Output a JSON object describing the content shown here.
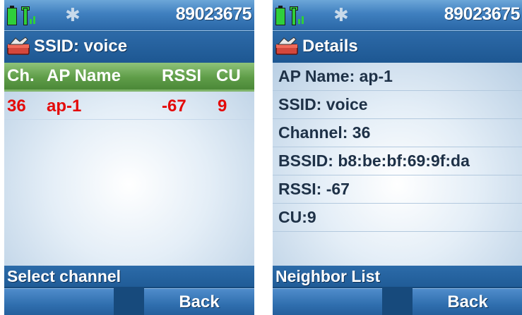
{
  "left_screen": {
    "status": {
      "number": "89023675",
      "battery_icon": "battery-icon",
      "signal_icon": "signal-icon",
      "bluetooth_icon": "bluetooth-icon"
    },
    "title": "SSID: voice",
    "table": {
      "headers": [
        "Ch.",
        "AP Name",
        "RSSI",
        "CU"
      ],
      "rows": [
        {
          "ch": "36",
          "ap_name": "ap-1",
          "rssi": "-67",
          "cu": "9"
        }
      ]
    },
    "bottom_label": "Select channel",
    "softkeys": {
      "left": "",
      "right": "Back"
    }
  },
  "right_screen": {
    "status": {
      "number": "89023675",
      "battery_icon": "battery-icon",
      "signal_icon": "signal-icon",
      "bluetooth_icon": "bluetooth-icon"
    },
    "title": "Details",
    "details": [
      "AP Name: ap-1",
      "SSID: voice",
      "Channel: 36",
      "BSSID: b8:be:bf:69:9f:da",
      "RSSI: -67",
      "CU:9"
    ],
    "bottom_label": "Neighbor List",
    "softkeys": {
      "left": "",
      "right": "Back"
    }
  },
  "colors": {
    "row_text_red": "#e40a0a",
    "header_green": "#5f9d48",
    "bar_blue": "#1f5a8e"
  }
}
